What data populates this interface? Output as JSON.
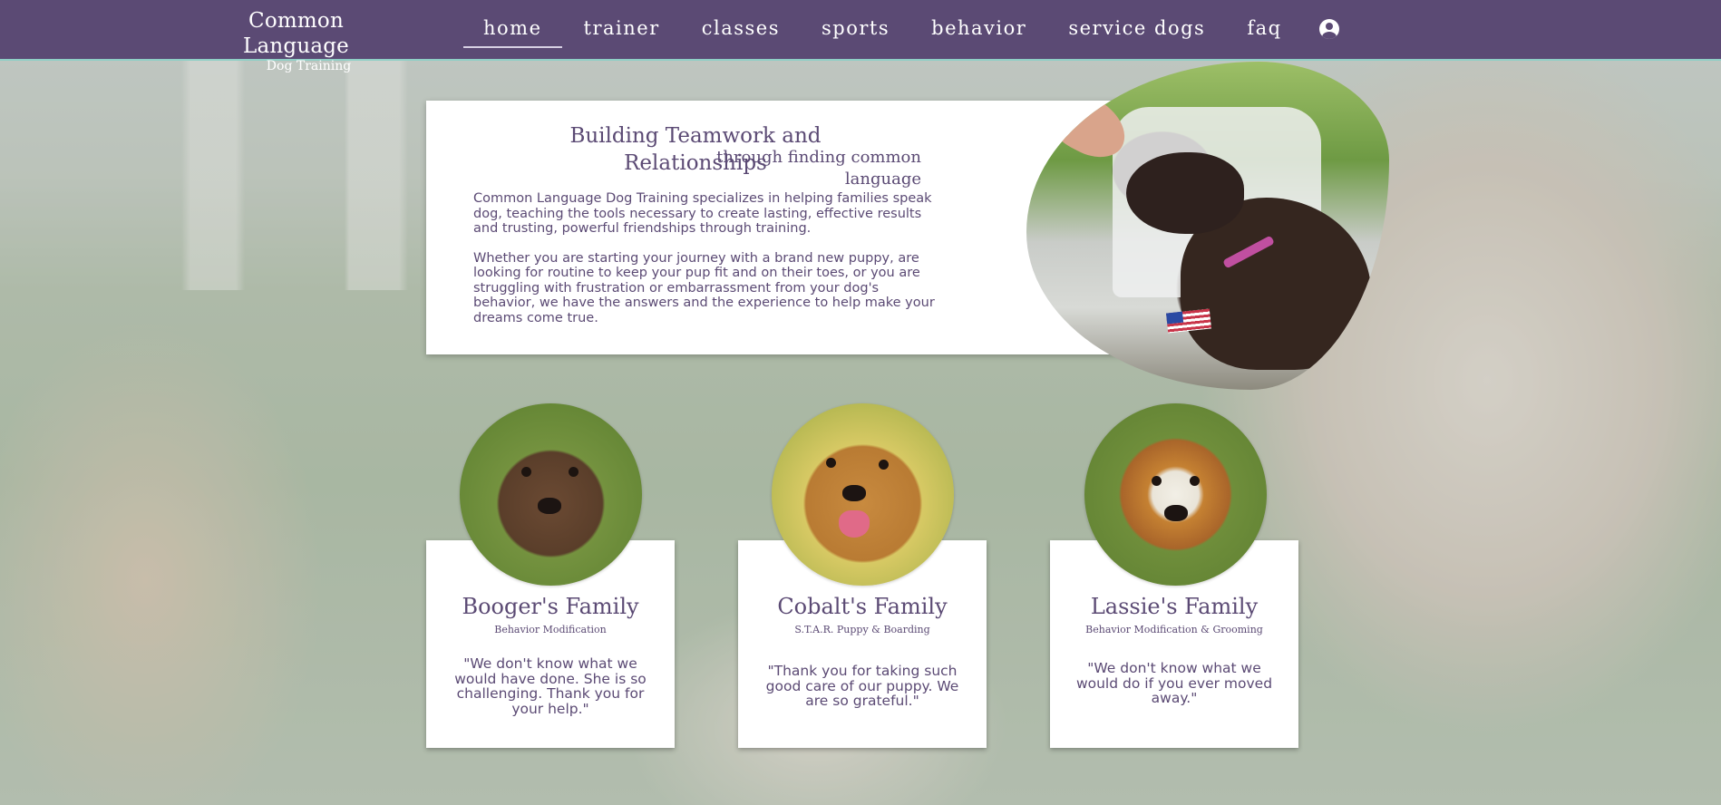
{
  "site": {
    "logo_title": "Common Language",
    "logo_subtitle": "Dog Training"
  },
  "nav": {
    "items": [
      "home",
      "trainer",
      "classes",
      "sports",
      "behavior",
      "service dogs",
      "faq"
    ],
    "active": "home"
  },
  "hero": {
    "title": "Building Teamwork and Relationships",
    "subtitle": "through finding common language",
    "paragraph_1": "Common Language Dog Training specializes in helping families speak dog, teaching the tools necessary to create lasting, effective results and trusting, powerful friendships through training.",
    "paragraph_2": "Whether you are starting your journey with a brand new puppy, are looking for routine to keep your pup fit and on their toes, or you are struggling with frustration or embarrassment from your dog's behavior, we have the answers and the experience to help make your dreams come true."
  },
  "testimonials": [
    {
      "name": "Booger's Family",
      "service": "Behavior Modification",
      "quote": "\"We don't know what we would have done. She is so challenging. Thank you for your help.\""
    },
    {
      "name": "Cobalt's Family",
      "service": "S.T.A.R. Puppy & Boarding",
      "quote": "\"Thank you for taking such good care of our puppy. We are so grateful.\""
    },
    {
      "name": "Lassie's Family",
      "service": "Behavior Modification & Grooming",
      "quote": "\"We don't know what we would do if you ever moved away.\""
    }
  ],
  "colors": {
    "header_bg": "#5b4a74",
    "accent_line": "#8fcfc6",
    "text_purple": "#5b4a74"
  },
  "icons": {
    "account": "user-circle-icon"
  }
}
